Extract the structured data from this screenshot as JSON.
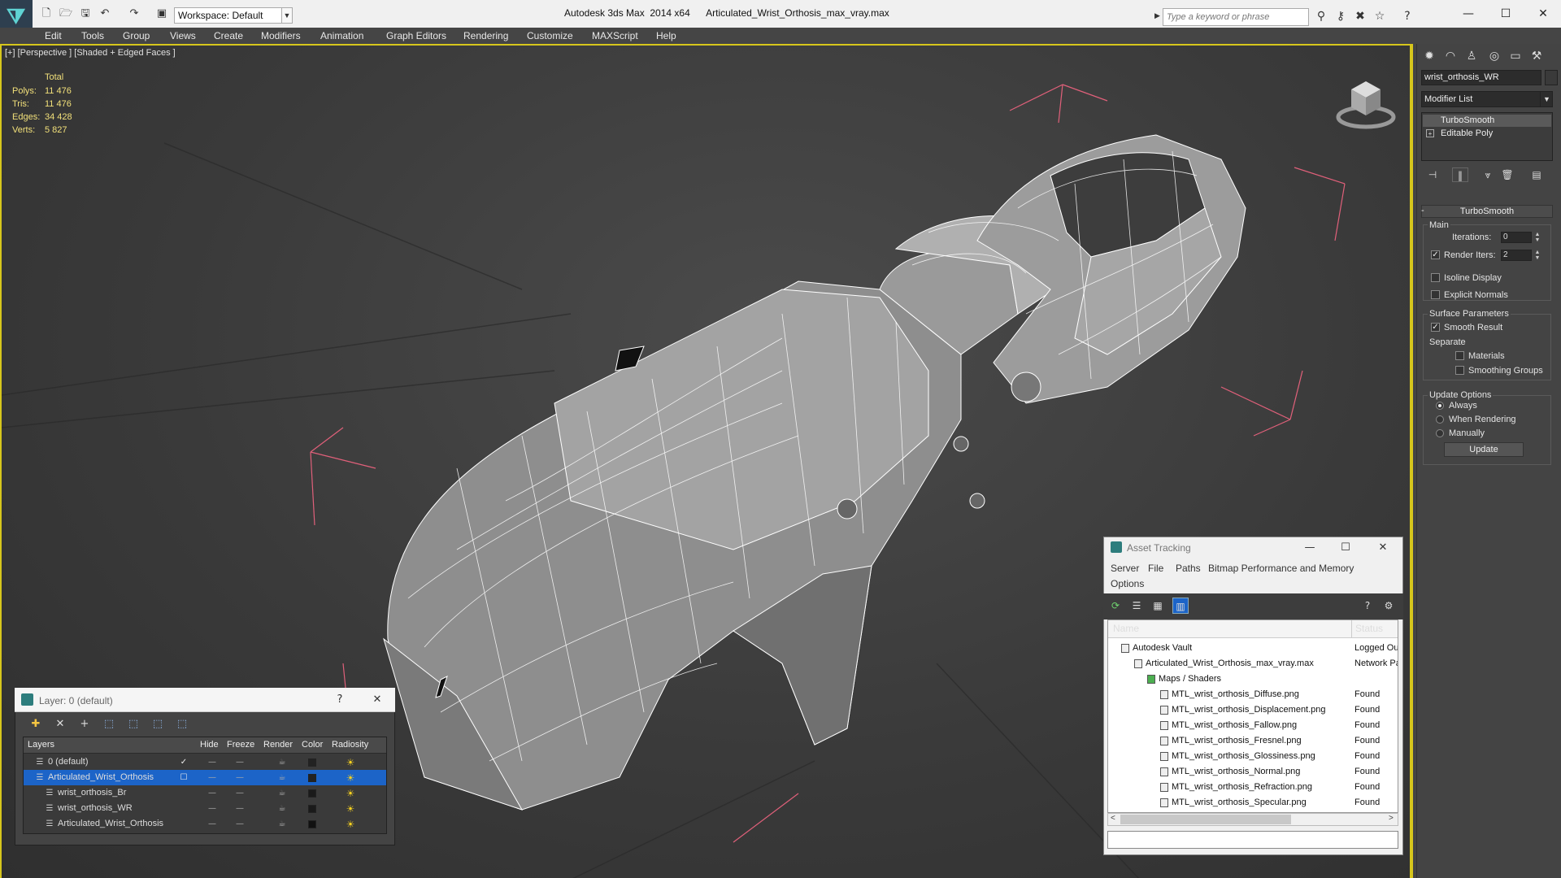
{
  "titlebar": {
    "app": "Autodesk 3ds Max  2014 x64",
    "file": "Articulated_Wrist_Orthosis_max_vray.max",
    "workspace": "Workspace: Default",
    "search_placeholder": "Type a keyword or phrase",
    "minimize": "—",
    "maximize": "☐",
    "close": "✕"
  },
  "menu": [
    "Edit",
    "Tools",
    "Group",
    "Views",
    "Create",
    "Modifiers",
    "Animation",
    "Graph Editors",
    "Rendering",
    "Customize",
    "MAXScript",
    "Help"
  ],
  "viewport": {
    "label": "[+] [Perspective ] [Shaded + Edged Faces ]",
    "stats_header": "Total",
    "stats": [
      {
        "label": "Polys:",
        "value": "11 476"
      },
      {
        "label": "Tris:",
        "value": "11 476"
      },
      {
        "label": "Edges:",
        "value": "34 428"
      },
      {
        "label": "Verts:",
        "value": "5 827"
      }
    ]
  },
  "command_panel": {
    "object_name": "wrist_orthosis_WR",
    "modifier_list": "Modifier List",
    "stack": [
      "TurboSmooth",
      "Editable Poly"
    ],
    "rollout_title": "TurboSmooth",
    "main_group": "Main",
    "iterations_label": "Iterations:",
    "iterations_value": "0",
    "render_iters_label": "Render Iters:",
    "render_iters_value": "2",
    "isoline_label": "Isoline Display",
    "explicit_normals_label": "Explicit Normals",
    "surface_group": "Surface Parameters",
    "smooth_result_label": "Smooth Result",
    "separate_label": "Separate",
    "materials_label": "Materials",
    "smoothing_groups_label": "Smoothing Groups",
    "update_group": "Update Options",
    "always_label": "Always",
    "when_rendering_label": "When Rendering",
    "manually_label": "Manually",
    "update_button": "Update"
  },
  "asset_tracking": {
    "title": "Asset Tracking",
    "menu": [
      "Server",
      "File",
      "Paths",
      "Bitmap Performance and Memory",
      "Options"
    ],
    "col_name": "Name",
    "col_status": "Status",
    "rows": [
      {
        "name": "Autodesk Vault",
        "status": "Logged Ou",
        "indent": 1
      },
      {
        "name": "Articulated_Wrist_Orthosis_max_vray.max",
        "status": "Network Pa",
        "indent": 2
      },
      {
        "name": "Maps / Shaders",
        "status": "",
        "indent": 3
      },
      {
        "name": "MTL_wrist_orthosis_Diffuse.png",
        "status": "Found",
        "indent": 4
      },
      {
        "name": "MTL_wrist_orthosis_Displacement.png",
        "status": "Found",
        "indent": 4
      },
      {
        "name": "MTL_wrist_orthosis_Fallow.png",
        "status": "Found",
        "indent": 4
      },
      {
        "name": "MTL_wrist_orthosis_Fresnel.png",
        "status": "Found",
        "indent": 4
      },
      {
        "name": "MTL_wrist_orthosis_Glossiness.png",
        "status": "Found",
        "indent": 4
      },
      {
        "name": "MTL_wrist_orthosis_Normal.png",
        "status": "Found",
        "indent": 4
      },
      {
        "name": "MTL_wrist_orthosis_Refraction.png",
        "status": "Found",
        "indent": 4
      },
      {
        "name": "MTL_wrist_orthosis_Specular.png",
        "status": "Found",
        "indent": 4
      }
    ]
  },
  "layers": {
    "title": "Layer: 0 (default)",
    "help": "?",
    "columns": [
      "Layers",
      "Hide",
      "Freeze",
      "Render",
      "Color",
      "Radiosity"
    ],
    "rows": [
      {
        "name": "0 (default)",
        "indent": 1,
        "selected": false,
        "current": true,
        "color": "#222222"
      },
      {
        "name": "Articulated_Wrist_Orthosis",
        "indent": 1,
        "selected": true,
        "current": false,
        "color": "#222222"
      },
      {
        "name": "wrist_orthosis_Br",
        "indent": 2,
        "selected": false,
        "current": false,
        "color": "#1a1a1a"
      },
      {
        "name": "wrist_orthosis_WR",
        "indent": 2,
        "selected": false,
        "current": false,
        "color": "#1a1a1a"
      },
      {
        "name": "Articulated_Wrist_Orthosis",
        "indent": 2,
        "selected": false,
        "current": false,
        "color": "#111111"
      }
    ]
  },
  "colors": {
    "viewport_border": "#d6c61c",
    "stats_text": "#f2e07a",
    "selection": "#1c64c8",
    "bbox_lines": "#e0607a"
  }
}
